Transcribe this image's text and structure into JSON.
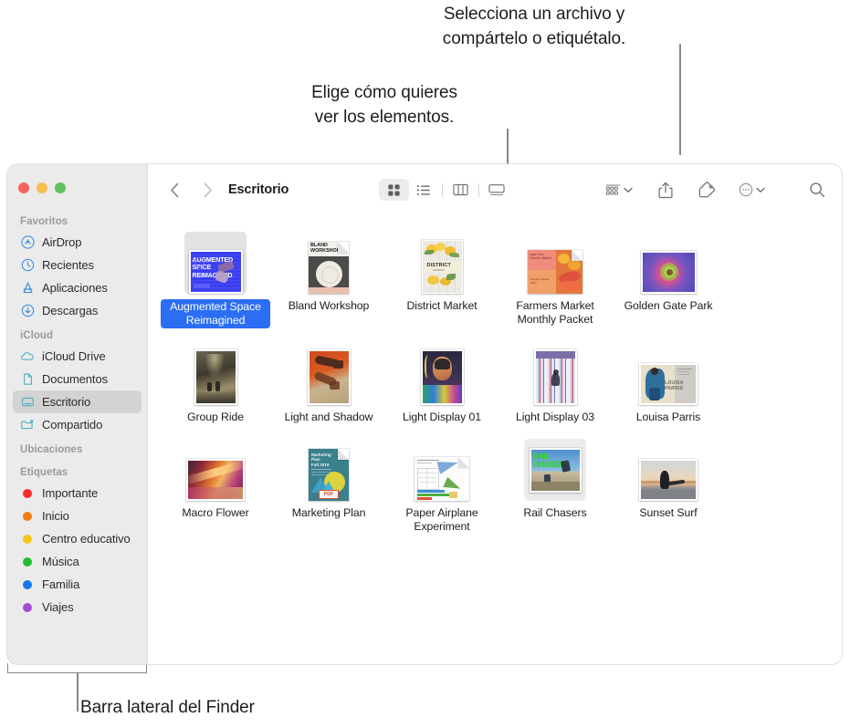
{
  "callouts": {
    "share_tag": "Selecciona un archivo y\ncompártelo o etiquétalo.",
    "view_options": "Elige cómo quieres\nver los elementos.",
    "sidebar": "Barra lateral del Finder"
  },
  "window": {
    "traffic_lights": [
      "close",
      "minimize",
      "zoom"
    ],
    "colors": {
      "close": "#f4645c",
      "minimize": "#f7be4f",
      "zoom": "#5ec35b",
      "selection_blue": "#2b6ef5",
      "sidebar_bg": "#ebebeb",
      "sidebar_selected": "#d3d3d3",
      "icon_gray": "#6e6e73",
      "accent_icon_blue": "#3f8fe0",
      "accent_icon_teal": "#4eb0c4"
    }
  },
  "toolbar": {
    "back_label": "Atrás",
    "forward_label": "Adelante",
    "path_title": "Escritorio",
    "view_buttons": [
      {
        "name": "icon-view",
        "label": "Vista de iconos",
        "selected": true
      },
      {
        "name": "list-view",
        "label": "Vista de lista",
        "selected": false
      },
      {
        "name": "column-view",
        "label": "Vista de columnas",
        "selected": false
      },
      {
        "name": "gallery-view",
        "label": "Vista de galería",
        "selected": false
      }
    ],
    "group_label": "Agrupar",
    "share_label": "Compartir",
    "tag_label": "Etiquetas",
    "more_label": "Más",
    "search_label": "Buscar"
  },
  "sidebar": {
    "sections": [
      {
        "header": "Favoritos",
        "items": [
          {
            "label": "AirDrop",
            "icon": "airdrop-icon",
            "selected": false
          },
          {
            "label": "Recientes",
            "icon": "clock-icon",
            "selected": false
          },
          {
            "label": "Aplicaciones",
            "icon": "applications-icon",
            "selected": false
          },
          {
            "label": "Descargas",
            "icon": "downloads-icon",
            "selected": false
          }
        ]
      },
      {
        "header": "iCloud",
        "items": [
          {
            "label": "iCloud Drive",
            "icon": "cloud-icon",
            "selected": false
          },
          {
            "label": "Documentos",
            "icon": "document-icon",
            "selected": false
          },
          {
            "label": "Escritorio",
            "icon": "desktop-icon",
            "selected": true
          },
          {
            "label": "Compartido",
            "icon": "shared-folder-icon",
            "selected": false
          }
        ]
      },
      {
        "header": "Ubicaciones",
        "items": []
      },
      {
        "header": "Etiquetas",
        "items": [
          {
            "label": "Importante",
            "icon": "tag-dot",
            "color": "#fb2b28",
            "selected": false
          },
          {
            "label": "Inicio",
            "icon": "tag-dot",
            "color": "#f07c14",
            "selected": false
          },
          {
            "label": "Centro educativo",
            "icon": "tag-dot",
            "color": "#f5c518",
            "selected": false
          },
          {
            "label": "Música",
            "icon": "tag-dot",
            "color": "#24c02c",
            "selected": false
          },
          {
            "label": "Familia",
            "icon": "tag-dot",
            "color": "#1478f0",
            "selected": false
          },
          {
            "label": "Viajes",
            "icon": "tag-dot",
            "color": "#a martially",
            "selected": false
          }
        ]
      }
    ]
  },
  "files": [
    {
      "name": "Augmented Space Reimagined",
      "kind": "poster-blue",
      "selected": true
    },
    {
      "name": "Bland Workshop",
      "kind": "doc-plate",
      "selected": false
    },
    {
      "name": "District Market",
      "kind": "photo-lemons",
      "selected": false
    },
    {
      "name": "Farmers Market Monthly Packet",
      "kind": "doc-market",
      "selected": false
    },
    {
      "name": "Golden Gate Park",
      "kind": "photo-flower-pink",
      "selected": false
    },
    {
      "name": "Group Ride",
      "kind": "photo-road",
      "selected": false
    },
    {
      "name": "Light and Shadow",
      "kind": "photo-hand",
      "selected": false
    },
    {
      "name": "Light Display 01",
      "kind": "photo-portrait",
      "selected": false
    },
    {
      "name": "Light Display 03",
      "kind": "photo-stripes",
      "selected": false
    },
    {
      "name": "Louisa Parris",
      "kind": "photo-louisa",
      "selected": false
    },
    {
      "name": "Macro Flower",
      "kind": "photo-macro",
      "selected": false
    },
    {
      "name": "Marketing Plan",
      "kind": "pdf-teal",
      "selected": false
    },
    {
      "name": "Paper Airplane Experiment",
      "kind": "doc-chart",
      "selected": false
    },
    {
      "name": "Rail Chasers",
      "kind": "photo-rail",
      "selected": false
    },
    {
      "name": "Sunset Surf",
      "kind": "photo-surf",
      "selected": false
    }
  ]
}
